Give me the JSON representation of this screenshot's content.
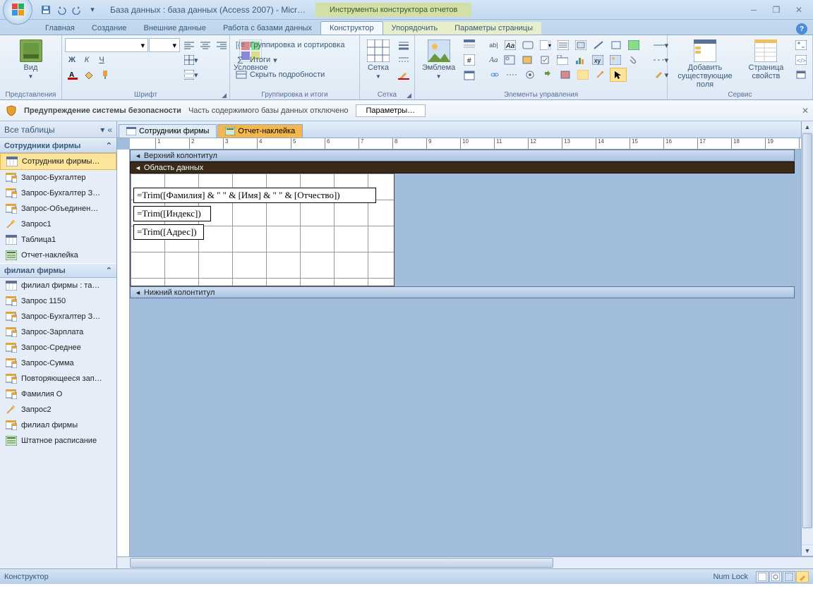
{
  "title": "База данных : база данных (Access 2007) - Micr…",
  "contextual_title": "Инструменты конструктора отчетов",
  "ribbon_tabs": {
    "home": "Главная",
    "create": "Создание",
    "external": "Внешние данные",
    "dbtools": "Работа с базами данных",
    "design": "Конструктор",
    "arrange": "Упорядочить",
    "pagesetup": "Параметры страницы"
  },
  "ribbon": {
    "views": {
      "label": "Представления",
      "view": "Вид"
    },
    "font": {
      "label": "Шрифт",
      "bold": "Ж",
      "italic": "К",
      "underline": "Ч"
    },
    "conditional": "Условное",
    "grouping": {
      "label": "Группировка и итоги",
      "group_sort": "Группировка и сортировка",
      "totals": "Итоги",
      "hide_details": "Скрыть подробности"
    },
    "grid": {
      "label": "Сетка",
      "gridlines": "Сетка"
    },
    "emblem": {
      "label": "Эмблема"
    },
    "controls": {
      "label": "Элементы управления"
    },
    "tools": {
      "label": "Сервис",
      "add_fields": "Добавить существующие поля",
      "prop_sheet": "Страница свойств"
    }
  },
  "security": {
    "title": "Предупреждение системы безопасности",
    "msg": "Часть содержимого базы данных отключено",
    "button": "Параметры…"
  },
  "nav": {
    "header": "Все таблицы",
    "group1": "Сотрудники фирмы",
    "items1": [
      "Сотрудники фирмы…",
      "Запрос-Бухгалтер",
      "Запрос-Бухгалтер З…",
      "Запрос-Объединен…",
      "Запрос1",
      "Таблица1",
      "Отчет-наклейка"
    ],
    "group2": "филиал фирмы",
    "items2": [
      "филиал фирмы : та…",
      "Запрос 1150",
      "Запрос-Бухгалтер З…",
      "Запрос-Зарплата",
      "Запрос-Среднее",
      "Запрос-Сумма",
      "Повторяющееся зап…",
      "Фамилия О",
      "Запрос2",
      "филиал фирмы",
      "Штатное расписание"
    ]
  },
  "tabs": {
    "t1": "Сотрудники фирмы",
    "t2": "Отчет-наклейка"
  },
  "sections": {
    "page_header": "Верхний колонтитул",
    "detail": "Область данных",
    "page_footer": "Нижний колонтитул"
  },
  "controls": {
    "c1": "=Trim([Фамилия] & \" \" & [Имя] & \" \" & [Отчество])",
    "c2": "=Trim([Индекс])",
    "c3": "=Trim([Адрес])"
  },
  "status": {
    "mode": "Конструктор",
    "numlock": "Num Lock"
  }
}
